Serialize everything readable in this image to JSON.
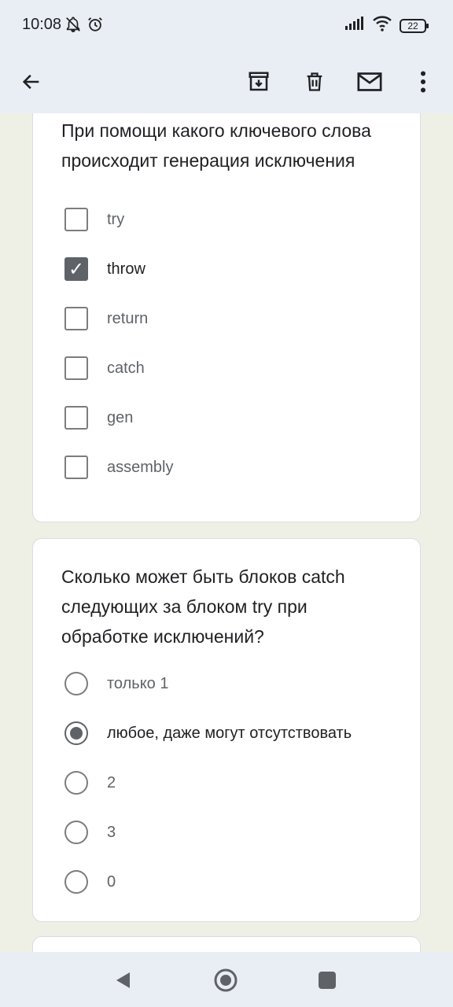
{
  "status_bar": {
    "time": "10:08",
    "battery": "22",
    "icons": [
      "muted-bell-icon",
      "alarm-icon",
      "signal-icon",
      "wifi-icon",
      "battery-icon"
    ]
  },
  "app_bar": {
    "icons": [
      "back-arrow-icon",
      "archive-icon",
      "delete-icon",
      "mail-icon",
      "more-vert-icon"
    ]
  },
  "questions": [
    {
      "text": "При помощи какого ключевого слова происходит генерация исключения",
      "type": "checkbox",
      "options": [
        {
          "label": "try",
          "selected": false
        },
        {
          "label": "throw",
          "selected": true
        },
        {
          "label": "return",
          "selected": false
        },
        {
          "label": "catch",
          "selected": false
        },
        {
          "label": "gen",
          "selected": false
        },
        {
          "label": "assembly",
          "selected": false
        }
      ]
    },
    {
      "text": "Сколько может быть блоков catch следующих за блоком try при обработке исключений?",
      "type": "radio",
      "options": [
        {
          "label": "только 1",
          "selected": false
        },
        {
          "label": "любое, даже могут отсутствовать",
          "selected": true
        },
        {
          "label": "2",
          "selected": false
        },
        {
          "label": "3",
          "selected": false
        },
        {
          "label": "0",
          "selected": false
        }
      ]
    }
  ],
  "nav_bar": {
    "icons": [
      "nav-back-icon",
      "nav-home-icon",
      "nav-recents-icon"
    ]
  },
  "colors": {
    "accent": "#5f6368",
    "bar_bg": "#e8eef4",
    "form_bg": "#eef0e6"
  }
}
